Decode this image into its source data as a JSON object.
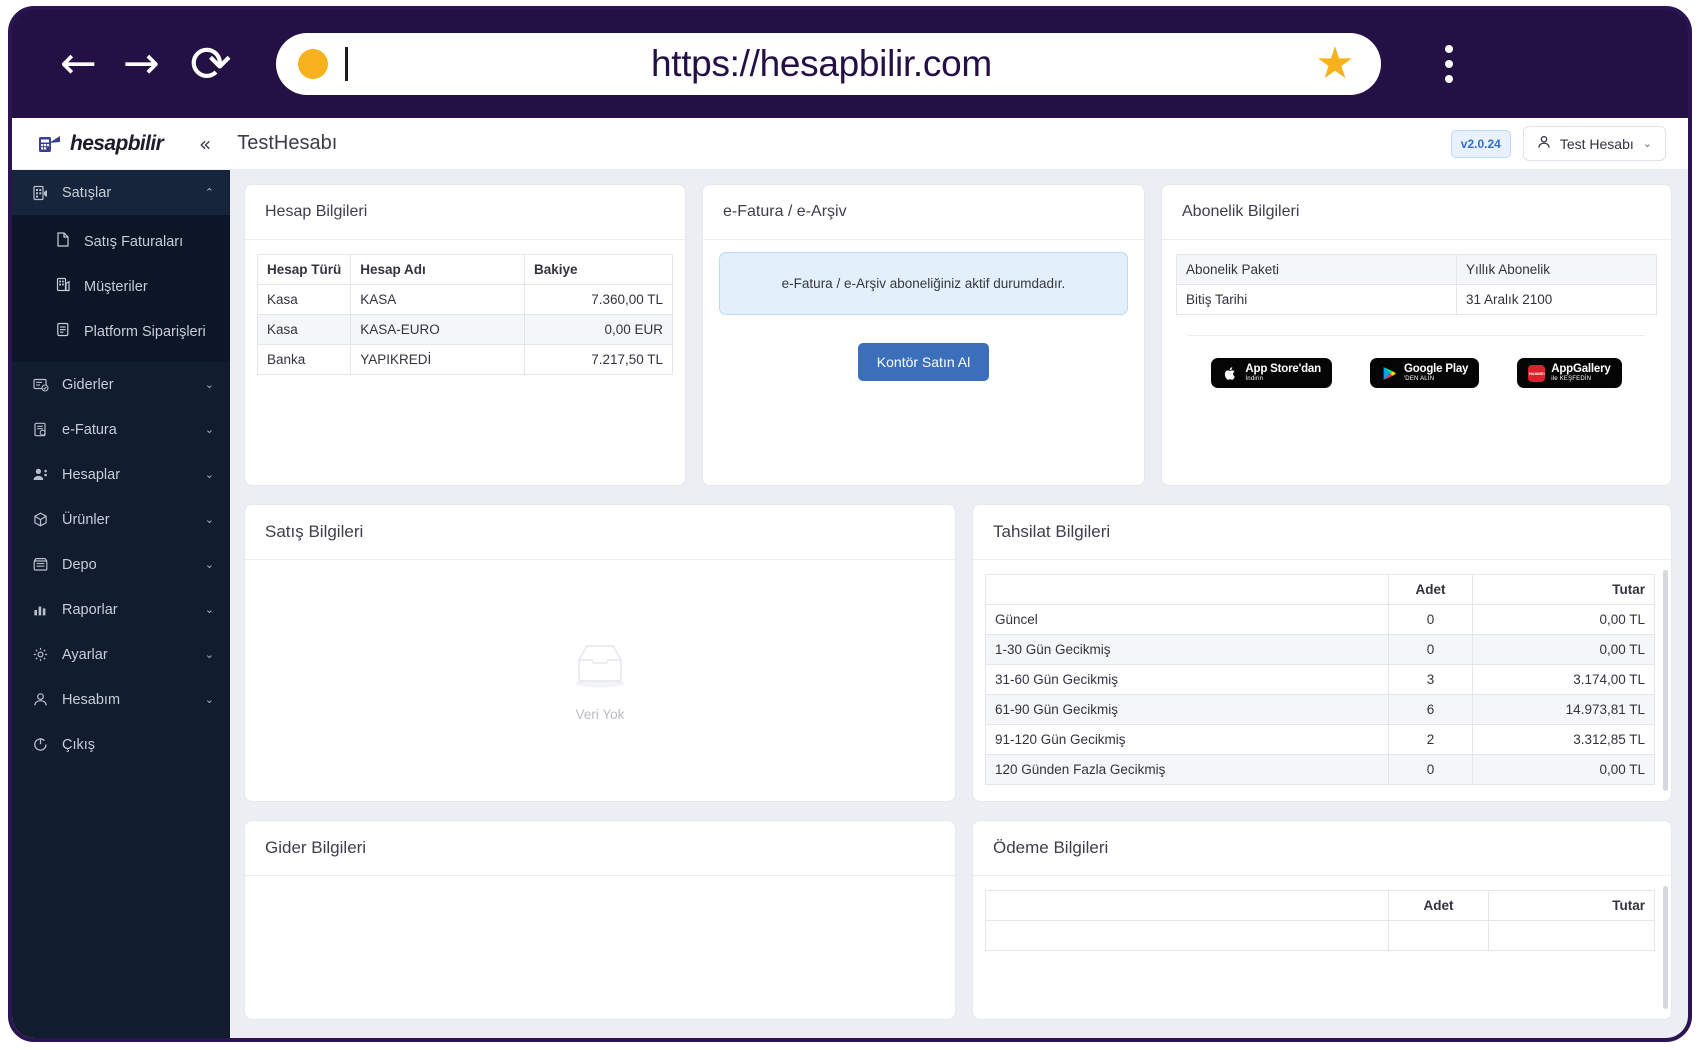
{
  "browser": {
    "back_icon": "←",
    "forward_icon": "→",
    "reload_icon": "⟳",
    "url": "https://hesapbilir.com",
    "star_icon": "★",
    "menu_icon": "kebab-menu"
  },
  "topbar": {
    "brand": "hesapbilir",
    "collapse_icon": "«",
    "page_title": "TestHesabı",
    "version": "v2.0.24",
    "user": "Test Hesabı",
    "user_chevron": "⌄"
  },
  "sidebar": {
    "items": [
      {
        "label": "Satışlar",
        "icon": "sales-icon",
        "arrow": "⌃",
        "active": true
      },
      {
        "label": "Giderler",
        "icon": "expenses-icon",
        "arrow": "⌄",
        "active": false
      },
      {
        "label": "e-Fatura",
        "icon": "einvoice-icon",
        "arrow": "⌄",
        "active": false
      },
      {
        "label": "Hesaplar",
        "icon": "accounts-icon",
        "arrow": "⌄",
        "active": false
      },
      {
        "label": "Ürünler",
        "icon": "products-icon",
        "arrow": "⌄",
        "active": false
      },
      {
        "label": "Depo",
        "icon": "warehouse-icon",
        "arrow": "⌄",
        "active": false
      },
      {
        "label": "Raporlar",
        "icon": "reports-icon",
        "arrow": "⌄",
        "active": false
      },
      {
        "label": "Ayarlar",
        "icon": "settings-icon",
        "arrow": "⌄",
        "active": false
      },
      {
        "label": "Hesabım",
        "icon": "profile-icon",
        "arrow": "⌄",
        "active": false
      },
      {
        "label": "Çıkış",
        "icon": "logout-icon",
        "arrow": "",
        "active": false
      }
    ],
    "submenu": [
      {
        "label": "Satış Faturaları",
        "icon": "invoice-icon"
      },
      {
        "label": "Müşteriler",
        "icon": "customers-icon"
      },
      {
        "label": "Platform Siparişleri",
        "icon": "platform-orders-icon"
      }
    ]
  },
  "cards": {
    "hesap_bilgileri": {
      "title": "Hesap Bilgileri",
      "columns": [
        "Hesap Türü",
        "Hesap Adı",
        "Bakiye"
      ],
      "rows": [
        {
          "tur": "Kasa",
          "ad": "KASA",
          "bakiye": "7.360,00 TL"
        },
        {
          "tur": "Kasa",
          "ad": "KASA-EURO",
          "bakiye": "0,00 EUR"
        },
        {
          "tur": "Banka",
          "ad": "YAPIKREDİ",
          "bakiye": "7.217,50 TL"
        }
      ]
    },
    "efatura": {
      "title": "e-Fatura / e-Arşiv",
      "alert": "e-Fatura / e-Arşiv aboneliğiniz aktif durumdadır.",
      "button": "Kontör Satın Al"
    },
    "abonelik": {
      "title": "Abonelik Bilgileri",
      "rows": [
        {
          "label": "Abonelik Paketi",
          "value": "Yıllık Abonelik"
        },
        {
          "label": "Bitiş Tarihi",
          "value": "31 Aralık 2100"
        }
      ],
      "stores": [
        {
          "icon": "apple-icon",
          "line1": "App Store'dan",
          "line2": "İndirin"
        },
        {
          "icon": "google-play-icon",
          "line1": "Google Play",
          "line2": "'DEN ALIN"
        },
        {
          "icon": "huawei-icon",
          "line1": "AppGallery",
          "line2": "ile KEŞFEDİN"
        }
      ]
    },
    "satis_bilgileri": {
      "title": "Satış Bilgileri",
      "empty_label": "Veri Yok"
    },
    "tahsilat_bilgileri": {
      "title": "Tahsilat Bilgileri",
      "columns": [
        "",
        "Adet",
        "Tutar"
      ],
      "rows": [
        {
          "label": "Güncel",
          "adet": "0",
          "tutar": "0,00 TL"
        },
        {
          "label": "1-30 Gün Gecikmiş",
          "adet": "0",
          "tutar": "0,00 TL"
        },
        {
          "label": "31-60 Gün Gecikmiş",
          "adet": "3",
          "tutar": "3.174,00 TL"
        },
        {
          "label": "61-90 Gün Gecikmiş",
          "adet": "6",
          "tutar": "14.973,81 TL"
        },
        {
          "label": "91-120 Gün Gecikmiş",
          "adet": "2",
          "tutar": "3.312,85 TL"
        },
        {
          "label": "120 Günden Fazla Gecikmiş",
          "adet": "0",
          "tutar": "0,00 TL"
        }
      ]
    },
    "gider_bilgileri": {
      "title": "Gider Bilgileri"
    },
    "odeme_bilgileri": {
      "title": "Ödeme Bilgileri",
      "columns": [
        "",
        "Adet",
        "Tutar"
      ]
    }
  }
}
